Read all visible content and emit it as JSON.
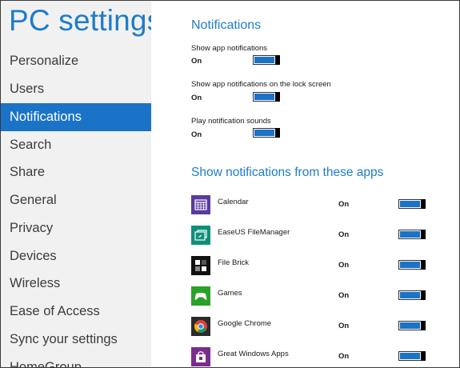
{
  "sidebar": {
    "title": "PC settings",
    "items": [
      {
        "label": "Personalize"
      },
      {
        "label": "Users"
      },
      {
        "label": "Notifications",
        "selected": true
      },
      {
        "label": "Search"
      },
      {
        "label": "Share"
      },
      {
        "label": "General"
      },
      {
        "label": "Privacy"
      },
      {
        "label": "Devices"
      },
      {
        "label": "Wireless"
      },
      {
        "label": "Ease of Access"
      },
      {
        "label": "Sync your settings"
      },
      {
        "label": "HomeGroup"
      }
    ]
  },
  "main": {
    "section_title": "Notifications",
    "settings": [
      {
        "label": "Show app notifications",
        "state": "On"
      },
      {
        "label": "Show app notifications on the lock screen",
        "state": "On"
      },
      {
        "label": "Play notification sounds",
        "state": "On"
      }
    ],
    "apps_title": "Show notifications from these apps",
    "apps": [
      {
        "name": "Calendar",
        "state": "On",
        "icon": "calendar-icon",
        "tile_color": "#5b3a9e"
      },
      {
        "name": "EaseUS FileManager",
        "state": "On",
        "icon": "file-manager-icon",
        "tile_color": "#0e8f7a"
      },
      {
        "name": "File Brick",
        "state": "On",
        "icon": "file-brick-icon",
        "tile_color": "#111111"
      },
      {
        "name": "Games",
        "state": "On",
        "icon": "game-controller-icon",
        "tile_color": "#2aa12a"
      },
      {
        "name": "Google Chrome",
        "state": "On",
        "icon": "chrome-icon",
        "tile_color": "#2b2b2b"
      },
      {
        "name": "Great Windows Apps",
        "state": "On",
        "icon": "windows-store-icon",
        "tile_color": "#7b2d8e"
      }
    ]
  },
  "colors": {
    "accent": "#1a73c7",
    "title_blue": "#1f7cc9",
    "sidebar_bg": "#f1f1f1"
  }
}
